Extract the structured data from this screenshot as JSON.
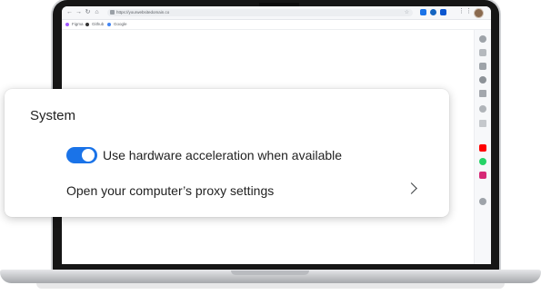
{
  "browser": {
    "url": "https://yourwebsitedomain.co",
    "bookmarks": [
      "Figma",
      "Github",
      "Google"
    ],
    "nav": {
      "back": "←",
      "forward": "→",
      "reload": "↻",
      "home": "⌂"
    },
    "menu_dots": "⋮",
    "star": "☆"
  },
  "settings": {
    "section_title": "System",
    "hardware_acceleration": {
      "label": "Use hardware acceleration when available",
      "enabled": true
    },
    "proxy": {
      "label": "Open your computer’s proxy settings"
    }
  },
  "colors": {
    "accent": "#1a73e8",
    "youtube": "#ff0000",
    "whatsapp": "#25d366",
    "instagram": "#d62976"
  },
  "side_panel_icons": [
    "compass-icon",
    "cube-icon",
    "puzzle-icon",
    "tag-icon",
    "note-icon",
    "shield-icon",
    "copy-icon",
    "youtube-icon",
    "whatsapp-icon",
    "instagram-icon",
    "gear-icon"
  ]
}
